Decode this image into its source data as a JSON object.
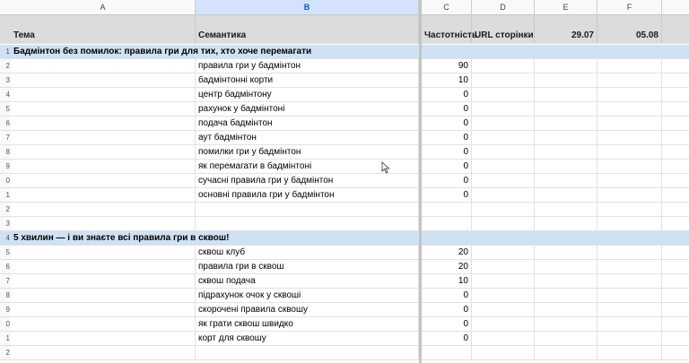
{
  "columns": [
    "A",
    "B",
    "C",
    "D",
    "E",
    "F"
  ],
  "header": {
    "row_num": "",
    "tema": "Тема",
    "semantyka": "Семантика",
    "chastotnist": "Частотність",
    "url": "URL сторінки",
    "date1": "29.07",
    "date2": "05.08"
  },
  "rows": [
    {
      "n": "1",
      "type": "section",
      "title": "Бадмінтон без помилок: правила гри для тих, хто хоче перемагати"
    },
    {
      "n": "2",
      "b": "правила гри у бадмінтон",
      "c": "90"
    },
    {
      "n": "3",
      "b": "бадмінтонні корти",
      "c": "10"
    },
    {
      "n": "4",
      "b": "центр бадмінтону",
      "c": "0"
    },
    {
      "n": "5",
      "b": "рахунок у бадмінтоні",
      "c": "0"
    },
    {
      "n": "6",
      "b": "подача бадмінтон",
      "c": "0"
    },
    {
      "n": "7",
      "b": "аут бадмінтон",
      "c": "0"
    },
    {
      "n": "8",
      "b": "помилки гри у бадмінтон",
      "c": "0"
    },
    {
      "n": "9",
      "b": "як перемагати в бадмінтоні",
      "c": "0"
    },
    {
      "n": "0",
      "b": "сучасні правила гри у бадмінтон",
      "c": "0"
    },
    {
      "n": "1",
      "b": "основні правила гри у бадмінтон",
      "c": "0"
    },
    {
      "n": "2",
      "b": "",
      "c": ""
    },
    {
      "n": "3",
      "b": "",
      "c": ""
    },
    {
      "n": "4",
      "type": "section",
      "title": "5 хвилин — і ви знаєте всі правила гри в сквош!"
    },
    {
      "n": "5",
      "b": "сквош клуб",
      "c": "20"
    },
    {
      "n": "6",
      "b": "правила гри в сквош",
      "c": "20"
    },
    {
      "n": "7",
      "b": "сквош подача",
      "c": "10"
    },
    {
      "n": "8",
      "b": "підрахунок очок у сквоші",
      "c": "0"
    },
    {
      "n": "9",
      "b": "скорочені правила сквошу",
      "c": "0"
    },
    {
      "n": "0",
      "b": "як грати сквош швидко",
      "c": "0"
    },
    {
      "n": "1",
      "b": "корт для сквошу",
      "c": "0"
    },
    {
      "n": "2",
      "b": "",
      "c": ""
    }
  ],
  "selected_column": "B",
  "icons": {
    "cursor": "mouse-pointer-icon"
  }
}
